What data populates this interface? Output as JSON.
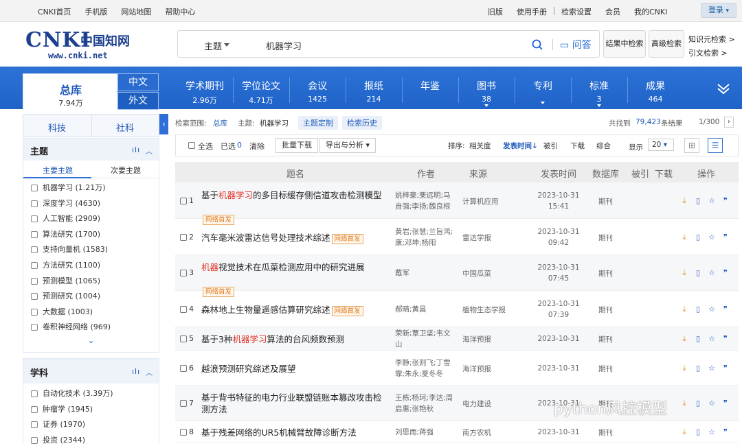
{
  "topbar": {
    "left": [
      "CNKI首页",
      "手机版",
      "网站地图",
      "帮助中心"
    ],
    "right": [
      "旧版",
      "使用手册",
      "检索设置",
      "会员",
      "我的CNKI"
    ],
    "login": "登录"
  },
  "logo": {
    "big": "CNKI",
    "cn": "中国知网",
    "url": "www.cnki.net"
  },
  "search": {
    "category": "主题",
    "query": "机器学习",
    "ask": "问答"
  },
  "buttons": {
    "in_result": "结果中检索",
    "advanced": "高级检索"
  },
  "side_links": [
    "知识元检索 >",
    "引文检索 >"
  ],
  "nav": {
    "zongku": {
      "label": "总库",
      "count": "7.94万"
    },
    "lang_cn": "中文",
    "lang_en": "外文",
    "items": [
      {
        "label": "学术期刊",
        "count": "2.96万"
      },
      {
        "label": "学位论文",
        "count": "4.71万"
      },
      {
        "label": "会议",
        "count": "1425"
      },
      {
        "label": "报纸",
        "count": "214"
      },
      {
        "label": "年鉴",
        "count": ""
      },
      {
        "label": "图书",
        "count": "38"
      },
      {
        "label": "专利",
        "count": ""
      },
      {
        "label": "标准",
        "count": "3"
      },
      {
        "label": "成果",
        "count": "464"
      }
    ]
  },
  "left": {
    "tabs": [
      "科技",
      "社科"
    ],
    "topic": {
      "title": "主题",
      "subtabs": [
        "主要主题",
        "次要主题"
      ],
      "items": [
        "机器学习 (1.21万)",
        "深度学习 (4630)",
        "人工智能 (2909)",
        "算法研究 (1700)",
        "支持向量机 (1583)",
        "方法研究 (1100)",
        "预测模型 (1065)",
        "预测研究 (1004)",
        "大数据 (1003)",
        "卷积神经网络 (969)"
      ]
    },
    "subject": {
      "title": "学科",
      "items": [
        "自动化技术 (3.39万)",
        "肿瘤学 (1945)",
        "证券 (1970)",
        "投资 (2344)"
      ]
    }
  },
  "filter": {
    "scope_label": "检索范围:",
    "scope": "总库",
    "topic_label": "主题:",
    "topic": "机器学习",
    "btn1": "主题定制",
    "btn2": "检索历史",
    "found_prefix": "共找到",
    "found": "79,423",
    "found_suffix": "条结果",
    "page": "1/300"
  },
  "toolbar": {
    "all": "全选",
    "selected": "已选",
    "selected_n": "0",
    "clear": "清除",
    "batch": "批量下载",
    "export": "导出与分析",
    "sort": "排序:",
    "s1": "相关度",
    "s2": "发表时间",
    "s3": "被引",
    "s4": "下载",
    "s5": "综合",
    "show": "显示",
    "show_n": "20"
  },
  "thead": [
    "题名",
    "作者",
    "来源",
    "发表时间",
    "数据库",
    "被引",
    "下载",
    "操作"
  ],
  "rows": [
    {
      "n": "1",
      "pre": "基于",
      "hl": "机器学习",
      "post": "的多目标缓存侧信道攻击检测模型",
      "badge": "网络首发",
      "author": "姚梓豪;栗远明;马自强;李扬;魏良根",
      "src": "计算机应用",
      "date": "2023-10-31",
      "time": "15:41",
      "db": "期刊"
    },
    {
      "n": "2",
      "pre": "汽车毫米波雷达信号处理技术综述",
      "hl": "",
      "post": "",
      "badge": "网络首发",
      "author": "黄岩;张慧;兰旨鸿;康;邓坤;杨阳",
      "src": "雷达学报",
      "date": "2023-10-31",
      "time": "09:42",
      "db": "期刊"
    },
    {
      "n": "3",
      "pre": "",
      "hl": "机器",
      "post": "视觉技术在瓜菜检测应用中的研究进展",
      "badge": "网络首发",
      "author": "戴军",
      "src": "中国瓜菜",
      "date": "2023-10-31",
      "time": "07:45",
      "db": "期刊"
    },
    {
      "n": "4",
      "pre": "森林地上生物量遥感估算研究综述",
      "hl": "",
      "post": "",
      "badge": "网络首发",
      "author": "郝晴;黄昌",
      "src": "植物生态学报",
      "date": "2023-10-31",
      "time": "07:39",
      "db": "期刊"
    },
    {
      "n": "5",
      "pre": "基于3种",
      "hl": "机器学习",
      "post": "算法的台风频数预测",
      "badge": "",
      "author": "荣新;覃卫坚;韦文山",
      "src": "海洋预报",
      "date": "2023-10-31",
      "time": "",
      "db": "期刊"
    },
    {
      "n": "6",
      "pre": "越浪预测研究综述及展望",
      "hl": "",
      "post": "",
      "badge": "",
      "author": "李静;张则飞;丁雪霏;朱永;夏冬冬",
      "src": "海洋预报",
      "date": "2023-10-31",
      "time": "",
      "db": "期刊"
    },
    {
      "n": "7",
      "pre": "基于背书特征的电力行业联盟链账本篡改攻击检测方法",
      "hl": "",
      "post": "",
      "badge": "",
      "author": "王栋;杨珂;李达;周启惠;张艳秋",
      "src": "电力建设",
      "date": "2023-10-31",
      "time": "",
      "db": "期刊"
    },
    {
      "n": "8",
      "pre": "基于残差网络的UR5机械臂故障诊断方法",
      "hl": "",
      "post": "",
      "badge": "",
      "author": "刘恩雨;蒋强",
      "src": "南方农机",
      "date": "2023-10-31",
      "time": "",
      "db": "期刊"
    }
  ],
  "watermark": "python风控模型"
}
